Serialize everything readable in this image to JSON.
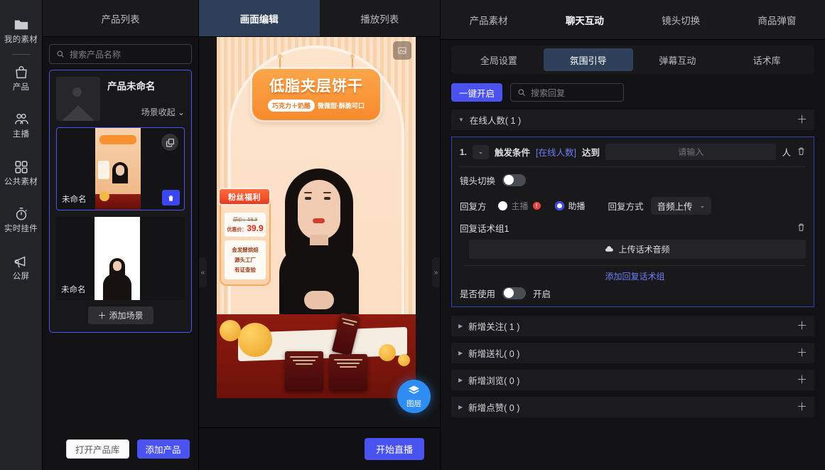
{
  "rail": {
    "items": [
      {
        "label": "我的素材",
        "icon": "folder-icon"
      },
      {
        "label": "产品",
        "icon": "bag-icon"
      },
      {
        "label": "主播",
        "icon": "anchor-person-icon"
      },
      {
        "label": "公共素材",
        "icon": "grid-icon"
      },
      {
        "label": "实时挂件",
        "icon": "stopwatch-icon"
      },
      {
        "label": "公屏",
        "icon": "megaphone-icon"
      }
    ]
  },
  "left_tabs": [
    {
      "label": "产品列表",
      "active": false
    },
    {
      "label": "画面编辑",
      "active": true
    },
    {
      "label": "播放列表",
      "active": false
    }
  ],
  "product_panel": {
    "search_placeholder": "搜索产品名称",
    "product": {
      "title": "产品未命名",
      "collapse_label": "场景收起"
    },
    "scenes": [
      {
        "name": "未命名",
        "selected": true
      },
      {
        "name": "未命名",
        "selected": false
      }
    ],
    "add_scene_label": "添加场景",
    "footer": {
      "open_library": "打开产品库",
      "add_product": "添加产品"
    }
  },
  "canvas": {
    "banner_title": "低脂夹层饼干",
    "banner_sub1": "巧克力＋奶酪",
    "banner_sub2": "微微甜·酥脆可口",
    "promo": {
      "ribbon": "粉丝福利",
      "old_price_label": "原价：59.9",
      "new_price_label": "优惠价：",
      "new_price": "39.9",
      "features": [
        "金发酵烘焙",
        "源头工厂",
        "有证查验"
      ]
    },
    "layer_button": "图层",
    "image_icon": "image-icon",
    "collapse_left": "«",
    "collapse_right": "»",
    "start_live": "开始直播"
  },
  "right_panel": {
    "tabs": [
      {
        "label": "产品素材",
        "active": false
      },
      {
        "label": "聊天互动",
        "active": true
      },
      {
        "label": "镜头切换",
        "active": false
      },
      {
        "label": "商品弹窗",
        "active": false
      }
    ],
    "subtabs": [
      {
        "label": "全局设置",
        "active": false
      },
      {
        "label": "氛围引导",
        "active": true
      },
      {
        "label": "弹幕互动",
        "active": false
      },
      {
        "label": "话术库",
        "active": false
      }
    ],
    "toolbar": {
      "onekey_label": "一键开启",
      "search_placeholder": "搜索回复"
    },
    "section_online": {
      "title": "在线人数( 1 )",
      "add_icon": "plus-icon",
      "rule": {
        "index": "1.",
        "trigger_label": "触发条件",
        "trigger_type": "[在线人数]",
        "reach_label": "达到",
        "value_placeholder": "请输入",
        "unit": "人",
        "delete_icon": "trash-icon"
      },
      "camera_switch_label": "镜头切换",
      "reply_side_label": "回复方",
      "reply_options": [
        {
          "label": "主播",
          "selected": false,
          "disabled": true,
          "warning": "!"
        },
        {
          "label": "助播",
          "selected": true,
          "disabled": false
        }
      ],
      "reply_mode_label": "回复方式",
      "reply_mode_value": "音频上传",
      "script_group_title": "回复话术组1",
      "upload_label": "上传话术音频",
      "add_group_label": "添加回复话术组",
      "use_label": "是否使用",
      "use_state": "开启"
    },
    "sections": [
      {
        "title": "新增关注( 1 )"
      },
      {
        "title": "新增送礼( 0 )"
      },
      {
        "title": "新增浏览( 0 )"
      },
      {
        "title": "新增点赞( 0 )"
      }
    ]
  },
  "colors": {
    "accent": "#4a52f0",
    "tab_active_bg": "#2e3f59",
    "link": "#6f7bf5",
    "warning": "#e8453c",
    "fab": "#2e8df5"
  }
}
